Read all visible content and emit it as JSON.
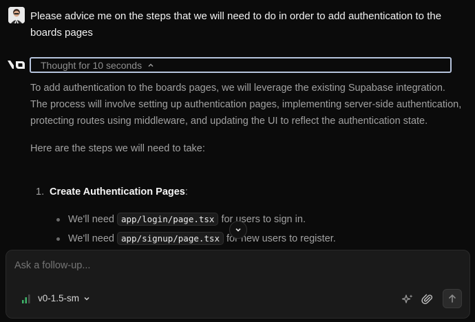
{
  "user_message": "Please advice me on the steps that we will need to do in order to add authentication to the boards pages",
  "thought_label": "Thought for 10 seconds",
  "answer": {
    "paragraphs": [
      "To add authentication to the boards pages, we will leverage the existing Supabase integration. The process will involve setting up authentication pages, implementing server-side authentication, protecting routes using middleware, and updating the UI to reflect the authentication state.",
      "Here are the steps we will need to take:"
    ],
    "steps": [
      {
        "number": "1.",
        "title": "Create Authentication Pages",
        "suffix": ":",
        "bullets": [
          {
            "pre": "We'll need",
            "code": "app/login/page.tsx",
            "post": "for users to sign in."
          },
          {
            "pre": "We'll need",
            "code": "app/signup/page.tsx",
            "post": "for new users to register."
          }
        ]
      }
    ]
  },
  "composer": {
    "placeholder": "Ask a follow-up...",
    "model_label": "v0-1.5-sm"
  },
  "icons": {
    "logo": "v0-logo",
    "thought_toggle": "chevron-up-icon",
    "scroll": "chevron-down-icon",
    "model": "signal-bars-icon",
    "enhance": "sparkles-icon",
    "attach": "paperclip-icon",
    "send": "arrow-up-icon"
  },
  "colors": {
    "background": "#0b0b0b",
    "focus_ring": "#b7c4dd",
    "model_bars": "#3fb56b"
  }
}
